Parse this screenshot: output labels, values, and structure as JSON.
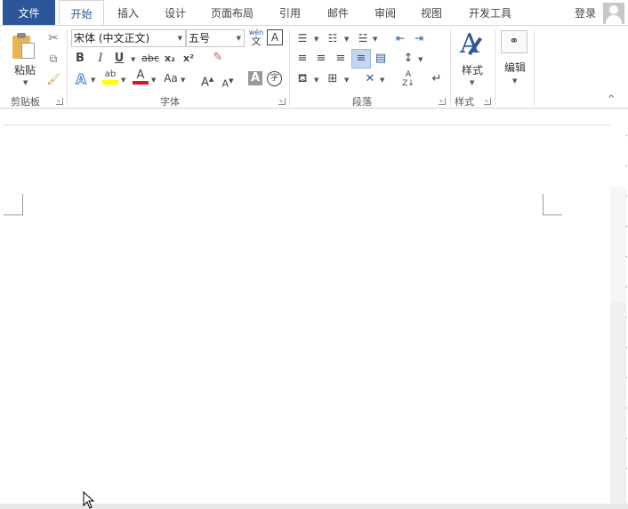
{
  "tabs": {
    "file": "文件",
    "home": "开始",
    "insert": "插入",
    "design": "设计",
    "layout": "页面布局",
    "references": "引用",
    "mailings": "邮件",
    "review": "审阅",
    "view": "视图",
    "developer": "开发工具"
  },
  "account": {
    "sign_in": "登录"
  },
  "clipboard": {
    "paste": "粘贴",
    "group": "剪贴板"
  },
  "font": {
    "name": "宋体 (中文正文)",
    "size": "五号",
    "pinyin_top": "wén",
    "pinyin_bottom": "文",
    "bold": "B",
    "italic": "I",
    "underline": "U",
    "strike": "abc",
    "subscript": "x₂",
    "superscript": "x²",
    "font_color_letter": "A",
    "case": "Aa",
    "grow": "A",
    "shrink": "A",
    "shading": "A",
    "enclose": "字",
    "group": "字体"
  },
  "paragraph": {
    "group": "段落"
  },
  "styles": {
    "label": "样式",
    "group": "样式"
  },
  "editing": {
    "label": "编辑"
  },
  "colors": {
    "accent": "#2b579a",
    "highlight": "#ffff00",
    "font_color": "#e81123"
  }
}
